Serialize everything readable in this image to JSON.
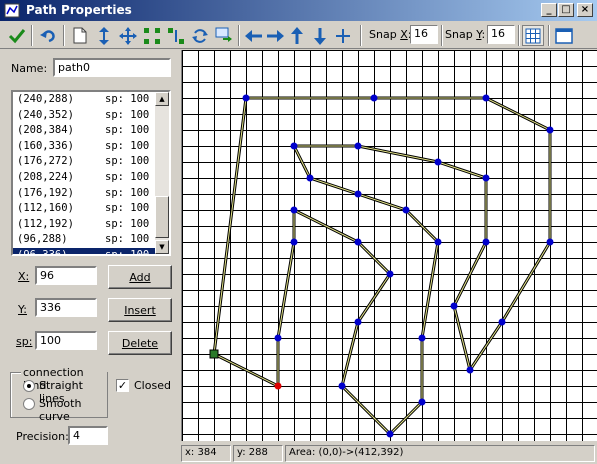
{
  "window": {
    "title": "Path Properties",
    "controls": {
      "minimize": "_",
      "maximize": "□",
      "close": "×"
    }
  },
  "toolbar": {
    "tools": [
      {
        "name": "ok-check-icon"
      },
      {
        "name": "undo-icon"
      },
      {
        "name": "new-document-icon"
      },
      {
        "name": "rotate-icon"
      },
      {
        "name": "move-icon"
      },
      {
        "name": "scale-horizontal-icon"
      },
      {
        "name": "scale-vertical-icon"
      },
      {
        "name": "cycle-icon"
      },
      {
        "name": "transform-icon"
      },
      {
        "name": "arrow-left-icon"
      },
      {
        "name": "arrow-right-icon"
      },
      {
        "name": "arrow-up-icon"
      },
      {
        "name": "arrow-down-icon"
      },
      {
        "name": "crosshair-icon"
      }
    ],
    "snap_x_label": "Snap",
    "snap_x_key": "X",
    "snap_x_value": "16",
    "snap_y_label": "Snap",
    "snap_y_key": "Y",
    "snap_y_value": "16",
    "grid_icon": "grid-icon",
    "view_icon": "window-view-icon"
  },
  "left": {
    "name_label": "Name:",
    "name_value": "path0",
    "points": [
      {
        "pt": "(240,288)",
        "sp": "sp: 100"
      },
      {
        "pt": "(240,352)",
        "sp": "sp: 100"
      },
      {
        "pt": "(208,384)",
        "sp": "sp: 100"
      },
      {
        "pt": "(160,336)",
        "sp": "sp: 100"
      },
      {
        "pt": "(176,272)",
        "sp": "sp: 100"
      },
      {
        "pt": "(208,224)",
        "sp": "sp: 100"
      },
      {
        "pt": "(176,192)",
        "sp": "sp: 100"
      },
      {
        "pt": "(112,160)",
        "sp": "sp: 100"
      },
      {
        "pt": "(112,192)",
        "sp": "sp: 100"
      },
      {
        "pt": "(96,288)",
        "sp": "sp: 100"
      },
      {
        "pt": "(96,336)",
        "sp": "sp: 100"
      }
    ],
    "selected_index": 10,
    "x_label": "X:",
    "x_value": "96",
    "y_label": "Y:",
    "y_value": "336",
    "sp_label": "sp:",
    "sp_value": "100",
    "add_label": "Add",
    "insert_label": "Insert",
    "delete_label": "Delete",
    "connection_label": "connection kind",
    "straight_label": "Straight lines",
    "smooth_label": "Smooth curve",
    "connection_selected": "straight",
    "closed_label": "Closed",
    "closed_checked": true,
    "precision_label": "Precision:",
    "precision_value": "4"
  },
  "status": {
    "x": "x: 384",
    "y": "y: 288",
    "area": "Area: (0,0)->(412,392)"
  },
  "colors": {
    "path_stroke": "#000000",
    "path_fill_line": "#e6e68a",
    "point": "#0000cc",
    "start_point": "#2a7a2a",
    "selected_point": "#dd0000",
    "grid": "#000000"
  },
  "path_geometry": {
    "closed": true,
    "start_index": 0,
    "selected_index": 10,
    "points": [
      [
        32,
        304
      ],
      [
        64,
        48
      ],
      [
        192,
        48
      ],
      [
        304,
        48
      ],
      [
        368,
        80
      ],
      [
        368,
        192
      ],
      [
        320,
        272
      ],
      [
        288,
        320
      ],
      [
        272,
        256
      ],
      [
        304,
        192
      ],
      [
        304,
        128
      ],
      [
        256,
        112
      ],
      [
        176,
        96
      ],
      [
        112,
        96
      ],
      [
        128,
        128
      ],
      [
        176,
        144
      ],
      [
        224,
        160
      ],
      [
        256,
        192
      ],
      [
        240,
        288
      ],
      [
        240,
        352
      ],
      [
        208,
        384
      ],
      [
        160,
        336
      ],
      [
        176,
        272
      ],
      [
        208,
        224
      ],
      [
        176,
        192
      ],
      [
        112,
        160
      ],
      [
        112,
        192
      ],
      [
        96,
        288
      ],
      [
        96,
        336
      ]
    ]
  }
}
